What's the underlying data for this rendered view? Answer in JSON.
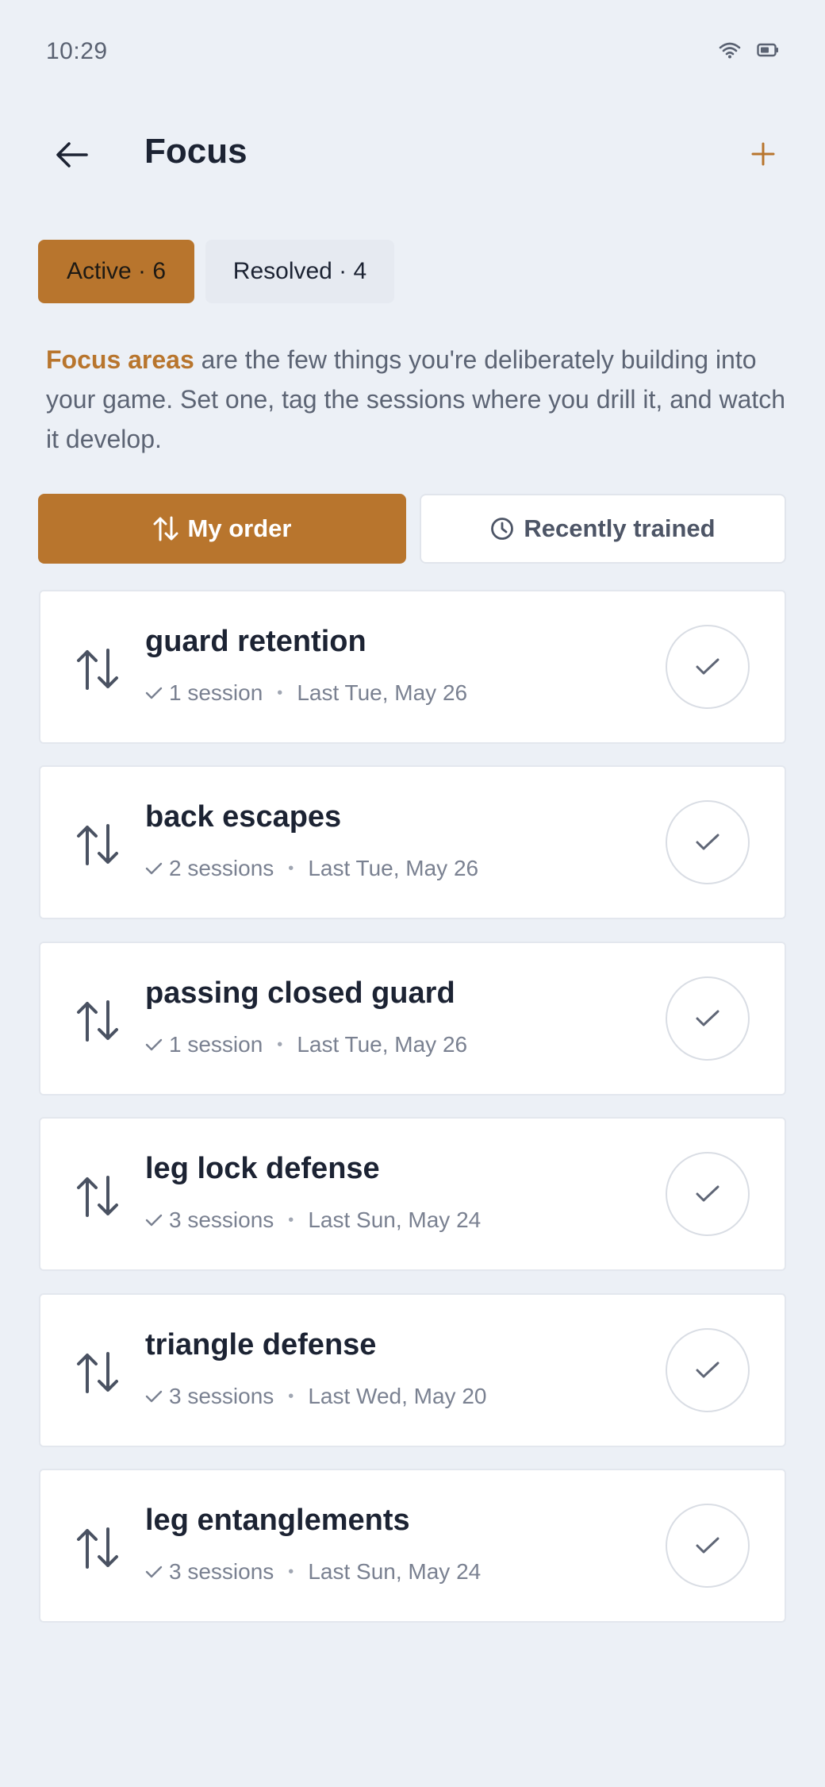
{
  "status": {
    "time": "10:29"
  },
  "header": {
    "title": "Focus"
  },
  "tabs": {
    "active_label": "Active · 6",
    "resolved_label": "Resolved · 4"
  },
  "intro": {
    "accent": "Focus areas",
    "text": " are the few things you're deliberately building into your game. Set one, tag the sessions where you drill it, and watch it develop."
  },
  "sort": {
    "my_order": "My order",
    "recently_trained": "Recently trained"
  },
  "colors": {
    "accent": "#b8752d",
    "background": "#ecf0f6"
  },
  "focus_items": [
    {
      "title": "guard retention",
      "sessions": "1 session",
      "last": "Last Tue, May 26"
    },
    {
      "title": "back escapes",
      "sessions": "2 sessions",
      "last": "Last Tue, May 26"
    },
    {
      "title": "passing closed guard",
      "sessions": "1 session",
      "last": "Last Tue, May 26"
    },
    {
      "title": "leg lock defense",
      "sessions": "3 sessions",
      "last": "Last Sun, May 24"
    },
    {
      "title": "triangle defense",
      "sessions": "3 sessions",
      "last": "Last Wed, May 20"
    },
    {
      "title": "leg entanglements",
      "sessions": "3 sessions",
      "last": "Last Sun, May 24"
    }
  ]
}
